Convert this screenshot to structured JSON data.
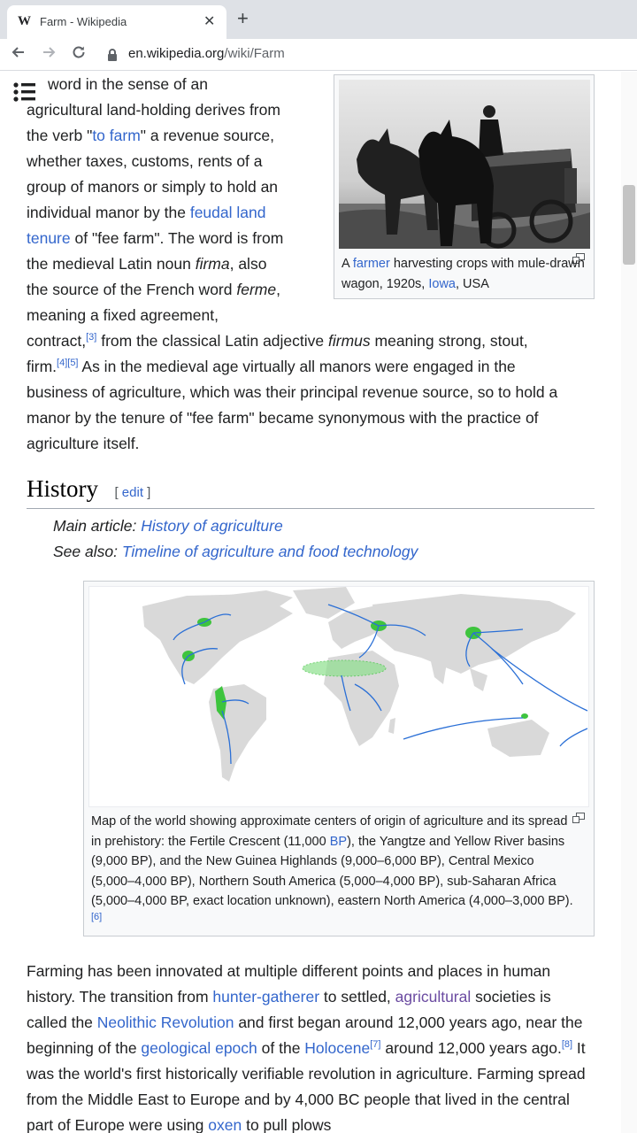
{
  "browser": {
    "tab_favicon": "W",
    "tab_title": "Farm - Wikipedia",
    "close_glyph": "✕",
    "new_tab_glyph": "+",
    "url_host": "en.wikipedia.org",
    "url_path": "/wiki/Farm"
  },
  "intro": {
    "l1": "word in the sense of an",
    "l2": "agricultural land-holding derives from",
    "l3a": "the verb \"",
    "l3_link": "to farm",
    "l3b": "\" a revenue source,",
    "l4": "whether taxes, customs, rents of a",
    "l5": "group of manors or simply to hold an",
    "l6a": "individual manor by the ",
    "l6_link": "feudal land",
    "l7_link": "tenure",
    "l7b": " of \"fee farm\". The word is from",
    "l8a": "the medieval Latin noun ",
    "l8_i": "firma",
    "l8b": ", also",
    "l9a": "the source of the French word ",
    "l9_i": "ferme",
    "l9b": ",",
    "l10": "meaning a fixed agreement,",
    "l11a": "contract,",
    "ref3": "[3]",
    "l11b": " from the classical Latin adjective ",
    "l11_i": "firmus",
    "l11c": " meaning strong, stout,",
    "l12a": "firm.",
    "ref45": "[4][5]",
    "l12b": " As in the medieval age virtually all manors were engaged in the",
    "l13": "business of agriculture, which was their principal revenue source, so to hold a",
    "l14": "manor by the tenure of \"fee farm\" became synonymous with the practice of",
    "l15": "agriculture itself."
  },
  "figure1": {
    "cap_a": "A ",
    "cap_link1": "farmer",
    "cap_b": " harvesting crops with mule-drawn wagon, 1920s, ",
    "cap_link2": "Iowa",
    "cap_c": ", USA"
  },
  "history": {
    "title": "History",
    "edit_open": "[ ",
    "edit_label": "edit",
    "edit_close": " ]",
    "main_label": "Main article: ",
    "main_link": "History of agriculture",
    "see_label": "See also: ",
    "see_link": "Timeline of agriculture and food technology"
  },
  "figure2": {
    "cap_a": "Map of the world showing approximate centers of origin of agriculture and its spread in prehistory: the Fertile Crescent (11,000 ",
    "cap_link": "BP",
    "cap_b": "), the Yangtze and Yellow River basins (9,000 BP), and the New Guinea Highlands (9,000–6,000 BP), Central Mexico (5,000–4,000 BP), Northern South America (5,000–4,000 BP), sub-Saharan Africa (5,000–4,000 BP, exact location unknown), eastern North America (4,000–3,000 BP).",
    "ref": "[6]"
  },
  "body": {
    "s1": "Farming has been innovated at multiple different points and places in human history. The transition from ",
    "link1": "hunter-gatherer",
    "s2": " to settled, ",
    "link2": "agricultural",
    "s3": " societies is called the ",
    "link3": "Neolithic Revolution",
    "s4": " and first began around 12,000 years ago, near the beginning of the ",
    "link4": "geological epoch",
    "s5": " of the ",
    "link5": "Holocene",
    "ref7": "[7]",
    "s6": " around 12,000 years ago.",
    "ref8": "[8]",
    "s7": " It was the world's first historically verifiable revolution in agriculture. Farming spread from the Middle East to Europe and by 4,000 BC people that lived in the central part of Europe were using ",
    "link6": "oxen",
    "s8": " to pull plows"
  },
  "colors": {
    "link": "#3366cc",
    "visited": "#6b4ba1",
    "origin_green": "#3ec43e",
    "arrow_blue": "#2a6fd6"
  }
}
